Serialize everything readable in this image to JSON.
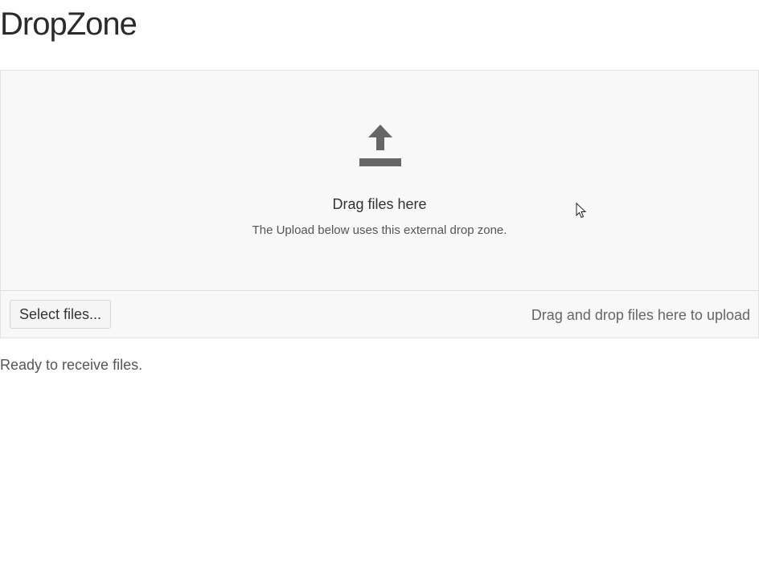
{
  "page": {
    "title": "DropZone"
  },
  "drop_zone": {
    "icon": "upload-icon",
    "title": "Drag files here",
    "hint": "The Upload below uses this external drop zone."
  },
  "upload": {
    "select_label": "Select files...",
    "hint": "Drag and drop files here to upload"
  },
  "status": {
    "text": "Ready to receive files."
  },
  "colors": {
    "icon": "#666666",
    "zone_background": "#f8f8f8",
    "border": "#e3e3e3"
  }
}
